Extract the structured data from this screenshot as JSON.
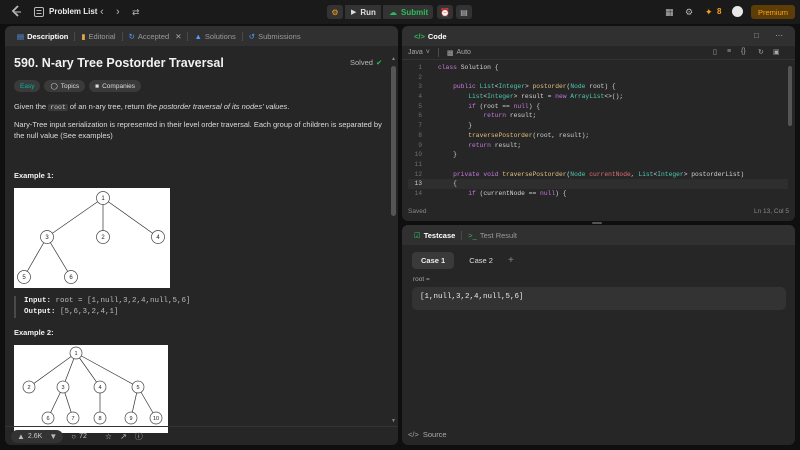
{
  "topbar": {
    "title": "Problem List",
    "run_label": "Run",
    "submit_label": "Submit",
    "streak": "8",
    "premium_label": "Premium"
  },
  "left_tabs": [
    {
      "label": "Description"
    },
    {
      "label": "Editorial"
    },
    {
      "label": "Accepted"
    },
    {
      "label": "Solutions"
    },
    {
      "label": "Submissions"
    }
  ],
  "problem": {
    "title": "590. N-ary Tree Postorder Traversal",
    "status": "Solved",
    "difficulty": "Easy",
    "topics_label": "Topics",
    "companies_label": "Companies",
    "desc_1a": "Given the ",
    "desc_1b": "root",
    "desc_1c": " of an n-ary tree, return ",
    "desc_1d": "the postorder traversal of its nodes' values",
    "desc_1e": ".",
    "desc_2": "Nary-Tree input serialization is represented in their level order traversal. Each group of children is separated by the null value (See examples)",
    "example1": {
      "heading": "Example 1:",
      "input_label": "Input:",
      "input_value": "root = [1,null,3,2,4,null,5,6]",
      "output_label": "Output:",
      "output_value": "[5,6,3,2,4,1]",
      "nodes": [
        "1",
        "3",
        "2",
        "4",
        "5",
        "6"
      ]
    },
    "example2": {
      "heading": "Example 2:",
      "nodes": [
        "1",
        "2",
        "3",
        "4",
        "5",
        "6",
        "7",
        "8",
        "9",
        "10"
      ]
    }
  },
  "bottom_bar": {
    "likes": "2.6K",
    "comments": "72"
  },
  "code_panel": {
    "title": "Code",
    "language": "Java",
    "mode": "Auto",
    "status_left": "Saved",
    "status_right": "Ln 13, Col 5",
    "line_numbers": [
      "1",
      "2",
      "3",
      "4",
      "5",
      "6",
      "7",
      "8",
      "9",
      "10",
      "11",
      "12",
      "13",
      "14"
    ]
  },
  "testcase_panel": {
    "tab_testcase": "Testcase",
    "tab_result": "Test Result",
    "case1": "Case 1",
    "case2": "Case 2",
    "add": "+",
    "var_label": "root =",
    "var_value": "[1,null,3,2,4,null,5,6]",
    "source_label": "Source"
  },
  "colors": {
    "accent_orange": "#ffa116",
    "submit_green": "#2cbb5d",
    "easy_teal": "#00b8a3",
    "premium_bg": "#5c3d08"
  }
}
